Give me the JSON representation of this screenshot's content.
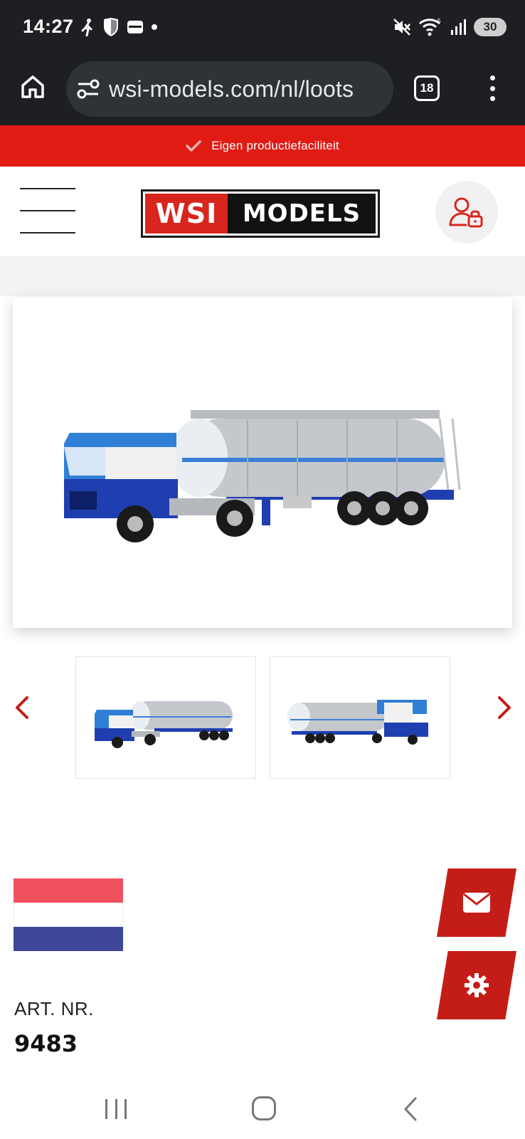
{
  "status_bar": {
    "time": "14:27",
    "battery": "30"
  },
  "browser": {
    "url": "wsi-models.com/nl/loots",
    "tab_count": "18"
  },
  "promo": {
    "text": "Eigen productiefaciliteit"
  },
  "header": {
    "logo_left": "WSI",
    "logo_right": "MODELS"
  },
  "product": {
    "art_label": "ART. NR.",
    "art_number": "9483",
    "truck_colors": {
      "cab_blue": "#2f7fd6",
      "chassis_blue": "#1f3fb0",
      "tank_silver": "#c4c7cc",
      "cab_white": "#f1f1f1"
    }
  },
  "colors": {
    "brand_red": "#e01b14",
    "fab_red": "#c41d17",
    "dark_bar": "#1d1f22"
  },
  "icons": {
    "walk": "walk-icon",
    "shield": "shield-icon",
    "wallet": "wallet-icon",
    "mute": "mute-icon",
    "wifi": "wifi-icon",
    "signal": "signal-icon",
    "home": "home-icon",
    "tune": "tune-icon",
    "check": "check-icon",
    "account_lock": "account-lock-icon",
    "mail": "mail-icon",
    "gear": "gear-icon",
    "chevron_left": "chevron-left-icon",
    "chevron_right": "chevron-right-icon"
  }
}
